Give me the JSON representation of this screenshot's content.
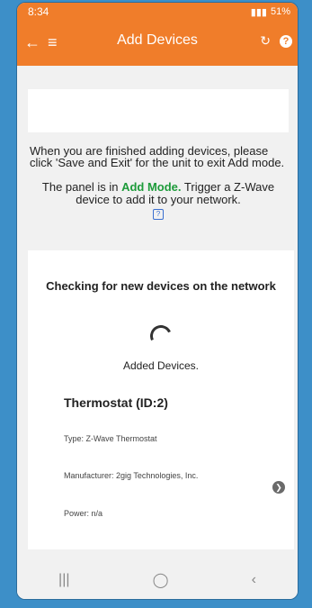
{
  "status": {
    "time": "8:34",
    "battery": "51%"
  },
  "appbar": {
    "title": "Add Devices",
    "help": "?"
  },
  "notice": "When you are finished adding devices, please click 'Save and Exit' for the unit to exit Add mode.",
  "mode": {
    "prefix": "The panel is in ",
    "mode_label": "Add Mode.",
    "suffix": " Trigger a Z-Wave device to add it to your network.",
    "help_icon": "?"
  },
  "scan": {
    "checking": "Checking for new devices on the network",
    "added_label": "Added Devices."
  },
  "device": {
    "name": "Thermostat (ID:2)",
    "type": "Type: Z-Wave Thermostat",
    "manufacturer": "Manufacturer: 2gig Technologies, Inc.",
    "power": "Power: n/a"
  },
  "colors": {
    "appbar": "#f07d2a",
    "mode_green": "#1d9b3a",
    "background": "#3d8fc8"
  },
  "icons": [
    "back-arrow-icon",
    "menu-icon",
    "refresh-icon",
    "help-icon",
    "chevron-right-icon"
  ]
}
